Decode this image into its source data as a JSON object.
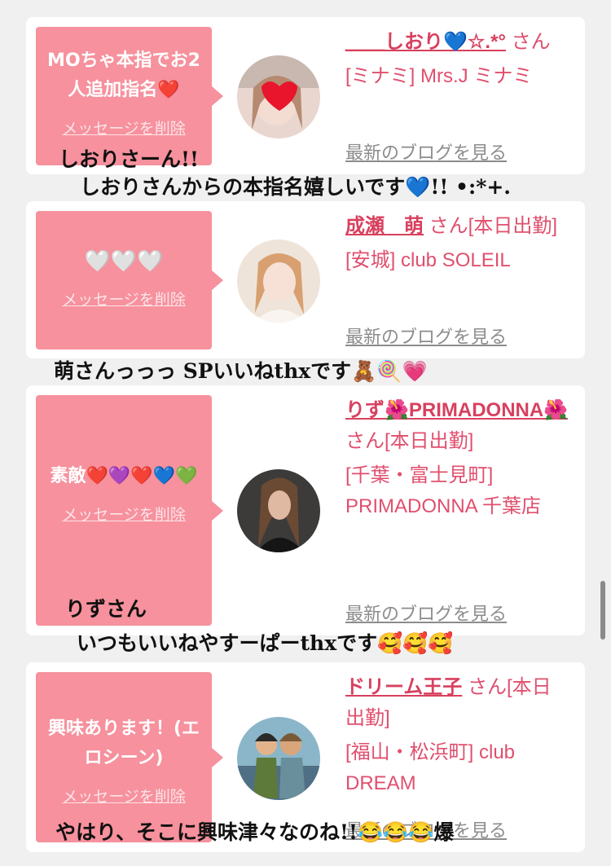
{
  "colors": {
    "bubble": "#f6919d",
    "accent": "#e04f6e",
    "background": "#f0f0f0"
  },
  "delete_label": "メッセージを削除",
  "blog_label": "最新のブログを見る",
  "cards": [
    {
      "message": "MOちゃ本指でお2人追加指名❤️",
      "name": "＿＿しおり💙☆.*°",
      "suffix": " さん",
      "shop": "[ミナミ] Mrs.J ミナミ",
      "avatar_icon": "girl-avatar-1"
    },
    {
      "message": "🤍🤍🤍",
      "name": "成瀬　萌",
      "suffix": " さん[本日出勤]",
      "shop": "[安城] club SOLEIL",
      "avatar_icon": "girl-avatar-2"
    },
    {
      "message": "素敵❤️💜❤️💙💚",
      "name": "りず🌺PRIMADONNA🌺",
      "suffix": " さん[本日出勤]",
      "shop": "[千葉・富士見町] PRIMADONNA 千葉店",
      "avatar_icon": "girl-avatar-3"
    },
    {
      "message": "興味あります！(エロシーン)",
      "name": "ドリーム王子",
      "suffix": " さん[本日出勤]",
      "shop": "[福山・松浜町] club DREAM",
      "avatar_icon": "anime-avatar-4"
    }
  ],
  "overlays": [
    "しおりさーん!!",
    "しおりさんからの本指名嬉しいです💙!! •:*+.",
    "萌さんっっっ SPいいねthxです🧸🍭💗",
    "りずさん",
    "いつもいいねやすーぱーthxです🥰🥰🥰",
    "やはり、そこに興味津々なのね!!😂😂😂爆"
  ]
}
